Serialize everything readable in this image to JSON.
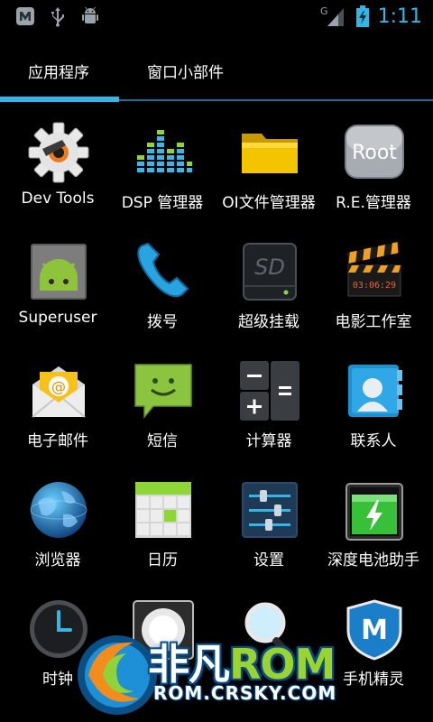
{
  "status_bar": {
    "left_icons": [
      "notification-app-icon",
      "usb-icon",
      "android-debug-icon"
    ],
    "signal": "G",
    "time": "1:11"
  },
  "tabs": [
    {
      "label": "应用程序",
      "active": true
    },
    {
      "label": "窗口小部件",
      "active": false
    }
  ],
  "apps": [
    {
      "label": "Dev Tools",
      "icon": "dev-tools-icon"
    },
    {
      "label": "DSP 管理器",
      "icon": "equalizer-icon"
    },
    {
      "label": "OI文件管理器",
      "icon": "folder-icon"
    },
    {
      "label": "R.E.管理器",
      "icon": "root-icon",
      "icon_text": "Root"
    },
    {
      "label": "Superuser",
      "icon": "superuser-android-icon"
    },
    {
      "label": "拨号",
      "icon": "phone-icon"
    },
    {
      "label": "超级挂载",
      "icon": "sd-card-icon",
      "icon_text": "SD"
    },
    {
      "label": "电影工作室",
      "icon": "clapperboard-icon",
      "icon_text": "03:06:29"
    },
    {
      "label": "电子邮件",
      "icon": "email-icon",
      "icon_text": "@"
    },
    {
      "label": "短信",
      "icon": "messaging-icon"
    },
    {
      "label": "计算器",
      "icon": "calculator-icon"
    },
    {
      "label": "联系人",
      "icon": "contacts-icon"
    },
    {
      "label": "浏览器",
      "icon": "browser-globe-icon"
    },
    {
      "label": "日历",
      "icon": "calendar-icon"
    },
    {
      "label": "设置",
      "icon": "settings-sliders-icon"
    },
    {
      "label": "深度电池助手",
      "icon": "battery-icon"
    },
    {
      "label": "时钟",
      "icon": "clock-icon"
    },
    {
      "label": "",
      "icon": "flashlight-icon"
    },
    {
      "label": "",
      "icon": "search-icon"
    },
    {
      "label": "手机精灵",
      "icon": "phone-sprite-icon",
      "icon_text": "M"
    }
  ],
  "watermark": {
    "brand_cn": "非凡",
    "brand_en": "ROM",
    "url": "ROM.CRSKY.COM"
  },
  "colors": {
    "accent": "#33b5e5",
    "background": "#000000"
  }
}
